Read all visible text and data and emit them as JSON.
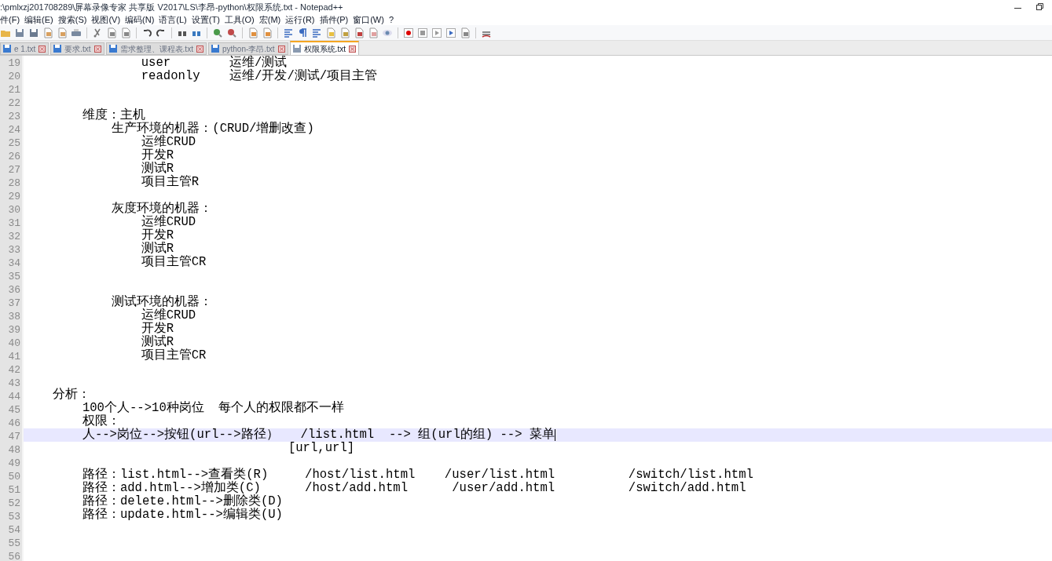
{
  "window": {
    "title": ":\\pmlxzj201708289\\屏幕录像专家 共享版 V2017\\LS\\李昂-python\\权限系统.txt - Notepad++"
  },
  "menu": [
    "件(F)",
    "编辑(E)",
    "搜索(S)",
    "视图(V)",
    "编码(N)",
    "语言(L)",
    "设置(T)",
    "工具(O)",
    "宏(M)",
    "运行(R)",
    "插件(P)",
    "窗口(W)",
    "?"
  ],
  "tabs": [
    {
      "label": "e 1.txt",
      "selected": false
    },
    {
      "label": "要求.txt",
      "selected": false
    },
    {
      "label": "需求整理、课程表.txt",
      "selected": false
    },
    {
      "label": "python-李昂.txt",
      "selected": false
    },
    {
      "label": "权限系统.txt",
      "selected": true
    }
  ],
  "editor": {
    "lines": [
      {
        "number": "19",
        "text": "\t\t\t\tuser\t\t运维/测试",
        "current": false
      },
      {
        "number": "20",
        "text": "\t\t\t\treadonly\t运维/开发/测试/项目主管",
        "current": false
      },
      {
        "number": "21",
        "current": false
      },
      {
        "number": "22",
        "current": false
      },
      {
        "number": "23",
        "text": "\t\t维度：主机",
        "current": false
      },
      {
        "number": "24",
        "text": "\t\t\t生产环境的机器：(CRUD/增删改查)",
        "current": false
      },
      {
        "number": "25",
        "text": "\t\t\t\t运维CRUD",
        "current": false
      },
      {
        "number": "26",
        "text": "\t\t\t\t开发R",
        "current": false
      },
      {
        "number": "27",
        "text": "\t\t\t\t测试R",
        "current": false
      },
      {
        "number": "28",
        "text": "\t\t\t\t项目主管R",
        "current": false
      },
      {
        "number": "29",
        "current": false
      },
      {
        "number": "30",
        "text": "\t\t\t灰度环境的机器：",
        "current": false
      },
      {
        "number": "31",
        "text": "\t\t\t\t运维CRUD",
        "current": false
      },
      {
        "number": "32",
        "text": "\t\t\t\t开发R",
        "current": false
      },
      {
        "number": "33",
        "text": "\t\t\t\t测试R",
        "current": false
      },
      {
        "number": "34",
        "text": "\t\t\t\t项目主管CR",
        "current": false
      },
      {
        "number": "35",
        "current": false
      },
      {
        "number": "36",
        "current": false
      },
      {
        "number": "37",
        "text": "\t\t\t测试环境的机器：",
        "current": false
      },
      {
        "number": "38",
        "text": "\t\t\t\t运维CRUD",
        "current": false
      },
      {
        "number": "39",
        "text": "\t\t\t\t开发R",
        "current": false
      },
      {
        "number": "40",
        "text": "\t\t\t\t测试R",
        "current": false
      },
      {
        "number": "41",
        "text": "\t\t\t\t项目主管CR",
        "current": false
      },
      {
        "number": "42",
        "current": false
      },
      {
        "number": "43",
        "current": false
      },
      {
        "number": "44",
        "text": "\t分析：",
        "current": false
      },
      {
        "number": "45",
        "text": "\t\t100个人-->10种岗位  每个人的权限都不一样",
        "current": false
      },
      {
        "number": "46",
        "text": "\t\t权限：",
        "current": false
      },
      {
        "number": "47",
        "text": "\t\t人-->岗位-->按钮(url-->路径）   /list.html  --> 组(url的组) --> 菜单",
        "current": true
      },
      {
        "number": "48",
        "text": "\t\t\t\t\t\t\t\t\t[url,url]",
        "current": false
      },
      {
        "number": "49",
        "current": false
      },
      {
        "number": "50",
        "text": "\t\t路径：list.html-->查看类(R)     /host/list.html    /user/list.html          /switch/list.html",
        "current": false
      },
      {
        "number": "51",
        "text": "\t\t路径：add.html-->增加类(C)      /host/add.html      /user/add.html          /switch/add.html",
        "current": false
      },
      {
        "number": "52",
        "text": "\t\t路径：delete.html-->删除类(D)",
        "current": false
      },
      {
        "number": "53",
        "text": "\t\t路径：update.html-->编辑类(U)",
        "current": false
      },
      {
        "number": "54",
        "current": false
      },
      {
        "number": "55",
        "current": false
      },
      {
        "number": "56",
        "current": false
      }
    ]
  }
}
